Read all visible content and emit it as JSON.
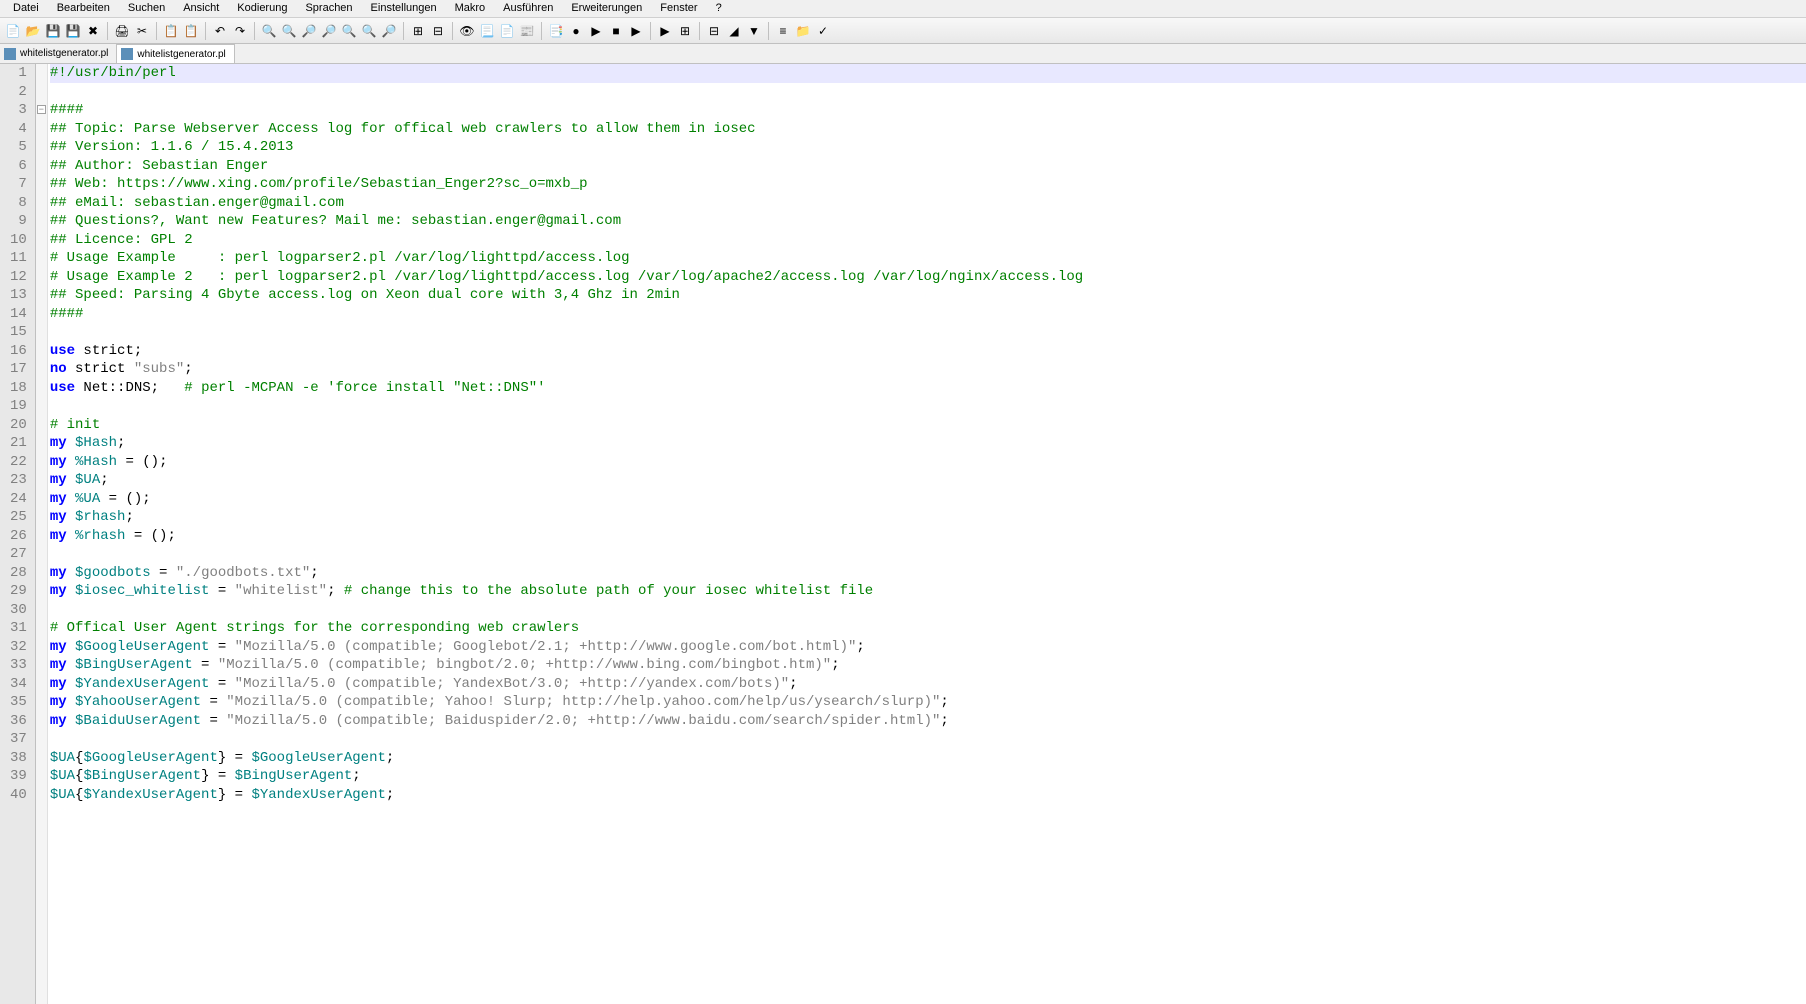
{
  "menu": {
    "items": [
      "Datei",
      "Bearbeiten",
      "Suchen",
      "Ansicht",
      "Kodierung",
      "Sprachen",
      "Einstellungen",
      "Makro",
      "Ausführen",
      "Erweiterungen",
      "Fenster",
      "?"
    ]
  },
  "toolbar": {
    "icons": [
      "📄",
      "📂",
      "💾",
      "💾",
      "✖",
      "🖨",
      "✂",
      "📋",
      "📋",
      "↶",
      "↷",
      "🔍",
      "🔍",
      "🔎",
      "🔎",
      "🔍",
      "🔍",
      "🔎",
      "⊞",
      "⊟",
      "👁",
      "📃",
      "📄",
      "📰",
      "📑",
      "●",
      "▶",
      "■",
      "▶",
      "▶",
      "⊞",
      "⊟",
      "◢",
      "▼",
      "≡",
      "📁",
      "✓"
    ]
  },
  "tabs": [
    {
      "name": "whitelistgenerator.pl",
      "active": false
    },
    {
      "name": "whitelistgenerator.pl",
      "active": true
    }
  ],
  "code": {
    "lines": [
      {
        "n": 1,
        "current": true,
        "tokens": [
          [
            "comment",
            "#!/usr/bin/perl"
          ]
        ]
      },
      {
        "n": 2,
        "tokens": []
      },
      {
        "n": 3,
        "fold": true,
        "tokens": [
          [
            "comment",
            "####"
          ]
        ]
      },
      {
        "n": 4,
        "tokens": [
          [
            "comment",
            "## Topic: Parse Webserver Access log for offical web crawlers to allow them in iosec"
          ]
        ]
      },
      {
        "n": 5,
        "tokens": [
          [
            "comment",
            "## Version: 1.1.6 / 15.4.2013"
          ]
        ]
      },
      {
        "n": 6,
        "tokens": [
          [
            "comment",
            "## Author: Sebastian Enger"
          ]
        ]
      },
      {
        "n": 7,
        "tokens": [
          [
            "comment",
            "## Web: https://www.xing.com/profile/Sebastian_Enger2?sc_o=mxb_p"
          ]
        ]
      },
      {
        "n": 8,
        "tokens": [
          [
            "comment",
            "## eMail: sebastian.enger@gmail.com"
          ]
        ]
      },
      {
        "n": 9,
        "tokens": [
          [
            "comment",
            "## Questions?, Want new Features? Mail me: sebastian.enger@gmail.com"
          ]
        ]
      },
      {
        "n": 10,
        "tokens": [
          [
            "comment",
            "## Licence: GPL 2"
          ]
        ]
      },
      {
        "n": 11,
        "tokens": [
          [
            "comment",
            "# Usage Example     : perl logparser2.pl /var/log/lighttpd/access.log"
          ]
        ]
      },
      {
        "n": 12,
        "tokens": [
          [
            "comment",
            "# Usage Example 2   : perl logparser2.pl /var/log/lighttpd/access.log /var/log/apache2/access.log /var/log/nginx/access.log"
          ]
        ]
      },
      {
        "n": 13,
        "tokens": [
          [
            "comment",
            "## Speed: Parsing 4 Gbyte access.log on Xeon dual core with 3,4 Ghz in 2min"
          ]
        ]
      },
      {
        "n": 14,
        "tokens": [
          [
            "comment",
            "####"
          ]
        ]
      },
      {
        "n": 15,
        "tokens": []
      },
      {
        "n": 16,
        "tokens": [
          [
            "keyword",
            "use"
          ],
          [
            "var",
            " strict"
          ],
          [
            "punct",
            ";"
          ]
        ]
      },
      {
        "n": 17,
        "tokens": [
          [
            "keyword",
            "no"
          ],
          [
            "var",
            " strict "
          ],
          [
            "string",
            "\"subs\""
          ],
          [
            "punct",
            ";"
          ]
        ]
      },
      {
        "n": 18,
        "tokens": [
          [
            "keyword",
            "use"
          ],
          [
            "var",
            " Net::DNS"
          ],
          [
            "punct",
            ";   "
          ],
          [
            "comment",
            "# perl -MCPAN -e 'force install \"Net::DNS\"'"
          ]
        ]
      },
      {
        "n": 19,
        "tokens": []
      },
      {
        "n": 20,
        "tokens": [
          [
            "comment",
            "# init"
          ]
        ]
      },
      {
        "n": 21,
        "tokens": [
          [
            "keyword",
            "my"
          ],
          [
            "var",
            " "
          ],
          [
            "ident",
            "$Hash"
          ],
          [
            "punct",
            ";"
          ]
        ]
      },
      {
        "n": 22,
        "tokens": [
          [
            "keyword",
            "my"
          ],
          [
            "var",
            " "
          ],
          [
            "ident",
            "%Hash"
          ],
          [
            "var",
            " = ()"
          ],
          [
            "punct",
            ";"
          ]
        ]
      },
      {
        "n": 23,
        "tokens": [
          [
            "keyword",
            "my"
          ],
          [
            "var",
            " "
          ],
          [
            "ident",
            "$UA"
          ],
          [
            "punct",
            ";"
          ]
        ]
      },
      {
        "n": 24,
        "tokens": [
          [
            "keyword",
            "my"
          ],
          [
            "var",
            " "
          ],
          [
            "ident",
            "%UA"
          ],
          [
            "var",
            " = ()"
          ],
          [
            "punct",
            ";"
          ]
        ]
      },
      {
        "n": 25,
        "tokens": [
          [
            "keyword",
            "my"
          ],
          [
            "var",
            " "
          ],
          [
            "ident",
            "$rhash"
          ],
          [
            "punct",
            ";"
          ]
        ]
      },
      {
        "n": 26,
        "tokens": [
          [
            "keyword",
            "my"
          ],
          [
            "var",
            " "
          ],
          [
            "ident",
            "%rhash"
          ],
          [
            "var",
            " = ()"
          ],
          [
            "punct",
            ";"
          ]
        ]
      },
      {
        "n": 27,
        "tokens": []
      },
      {
        "n": 28,
        "tokens": [
          [
            "keyword",
            "my"
          ],
          [
            "var",
            " "
          ],
          [
            "ident",
            "$goodbots"
          ],
          [
            "var",
            " = "
          ],
          [
            "string",
            "\"./goodbots.txt\""
          ],
          [
            "punct",
            ";"
          ]
        ]
      },
      {
        "n": 29,
        "tokens": [
          [
            "keyword",
            "my"
          ],
          [
            "var",
            " "
          ],
          [
            "ident",
            "$iosec_whitelist"
          ],
          [
            "var",
            " = "
          ],
          [
            "string",
            "\"whitelist\""
          ],
          [
            "punct",
            "; "
          ],
          [
            "comment",
            "# change this to the absolute path of your iosec whitelist file"
          ]
        ]
      },
      {
        "n": 30,
        "tokens": []
      },
      {
        "n": 31,
        "tokens": [
          [
            "comment",
            "# Offical User Agent strings for the corresponding web crawlers"
          ]
        ]
      },
      {
        "n": 32,
        "tokens": [
          [
            "keyword",
            "my"
          ],
          [
            "var",
            " "
          ],
          [
            "ident",
            "$GoogleUserAgent"
          ],
          [
            "var",
            " = "
          ],
          [
            "string",
            "\"Mozilla/5.0 (compatible; Googlebot/2.1; +http://www.google.com/bot.html)\""
          ],
          [
            "punct",
            ";"
          ]
        ]
      },
      {
        "n": 33,
        "tokens": [
          [
            "keyword",
            "my"
          ],
          [
            "var",
            " "
          ],
          [
            "ident",
            "$BingUserAgent"
          ],
          [
            "var",
            " = "
          ],
          [
            "string",
            "\"Mozilla/5.0 (compatible; bingbot/2.0; +http://www.bing.com/bingbot.htm)\""
          ],
          [
            "punct",
            ";"
          ]
        ]
      },
      {
        "n": 34,
        "tokens": [
          [
            "keyword",
            "my"
          ],
          [
            "var",
            " "
          ],
          [
            "ident",
            "$YandexUserAgent"
          ],
          [
            "var",
            " = "
          ],
          [
            "string",
            "\"Mozilla/5.0 (compatible; YandexBot/3.0; +http://yandex.com/bots)\""
          ],
          [
            "punct",
            ";"
          ]
        ]
      },
      {
        "n": 35,
        "tokens": [
          [
            "keyword",
            "my"
          ],
          [
            "var",
            " "
          ],
          [
            "ident",
            "$YahooUserAgent"
          ],
          [
            "var",
            " = "
          ],
          [
            "string",
            "\"Mozilla/5.0 (compatible; Yahoo! Slurp; http://help.yahoo.com/help/us/ysearch/slurp)\""
          ],
          [
            "punct",
            ";"
          ]
        ]
      },
      {
        "n": 36,
        "tokens": [
          [
            "keyword",
            "my"
          ],
          [
            "var",
            " "
          ],
          [
            "ident",
            "$BaiduUserAgent"
          ],
          [
            "var",
            " = "
          ],
          [
            "string",
            "\"Mozilla/5.0 (compatible; Baiduspider/2.0; +http://www.baidu.com/search/spider.html)\""
          ],
          [
            "punct",
            ";"
          ]
        ]
      },
      {
        "n": 37,
        "tokens": []
      },
      {
        "n": 38,
        "tokens": [
          [
            "ident",
            "$UA"
          ],
          [
            "punct",
            "{"
          ],
          [
            "ident",
            "$GoogleUserAgent"
          ],
          [
            "punct",
            "} = "
          ],
          [
            "ident",
            "$GoogleUserAgent"
          ],
          [
            "punct",
            ";"
          ]
        ]
      },
      {
        "n": 39,
        "tokens": [
          [
            "ident",
            "$UA"
          ],
          [
            "punct",
            "{"
          ],
          [
            "ident",
            "$BingUserAgent"
          ],
          [
            "punct",
            "} = "
          ],
          [
            "ident",
            "$BingUserAgent"
          ],
          [
            "punct",
            ";"
          ]
        ]
      },
      {
        "n": 40,
        "tokens": [
          [
            "ident",
            "$UA"
          ],
          [
            "punct",
            "{"
          ],
          [
            "ident",
            "$YandexUserAgent"
          ],
          [
            "punct",
            "} = "
          ],
          [
            "ident",
            "$YandexUserAgent"
          ],
          [
            "punct",
            ";"
          ]
        ]
      }
    ]
  }
}
